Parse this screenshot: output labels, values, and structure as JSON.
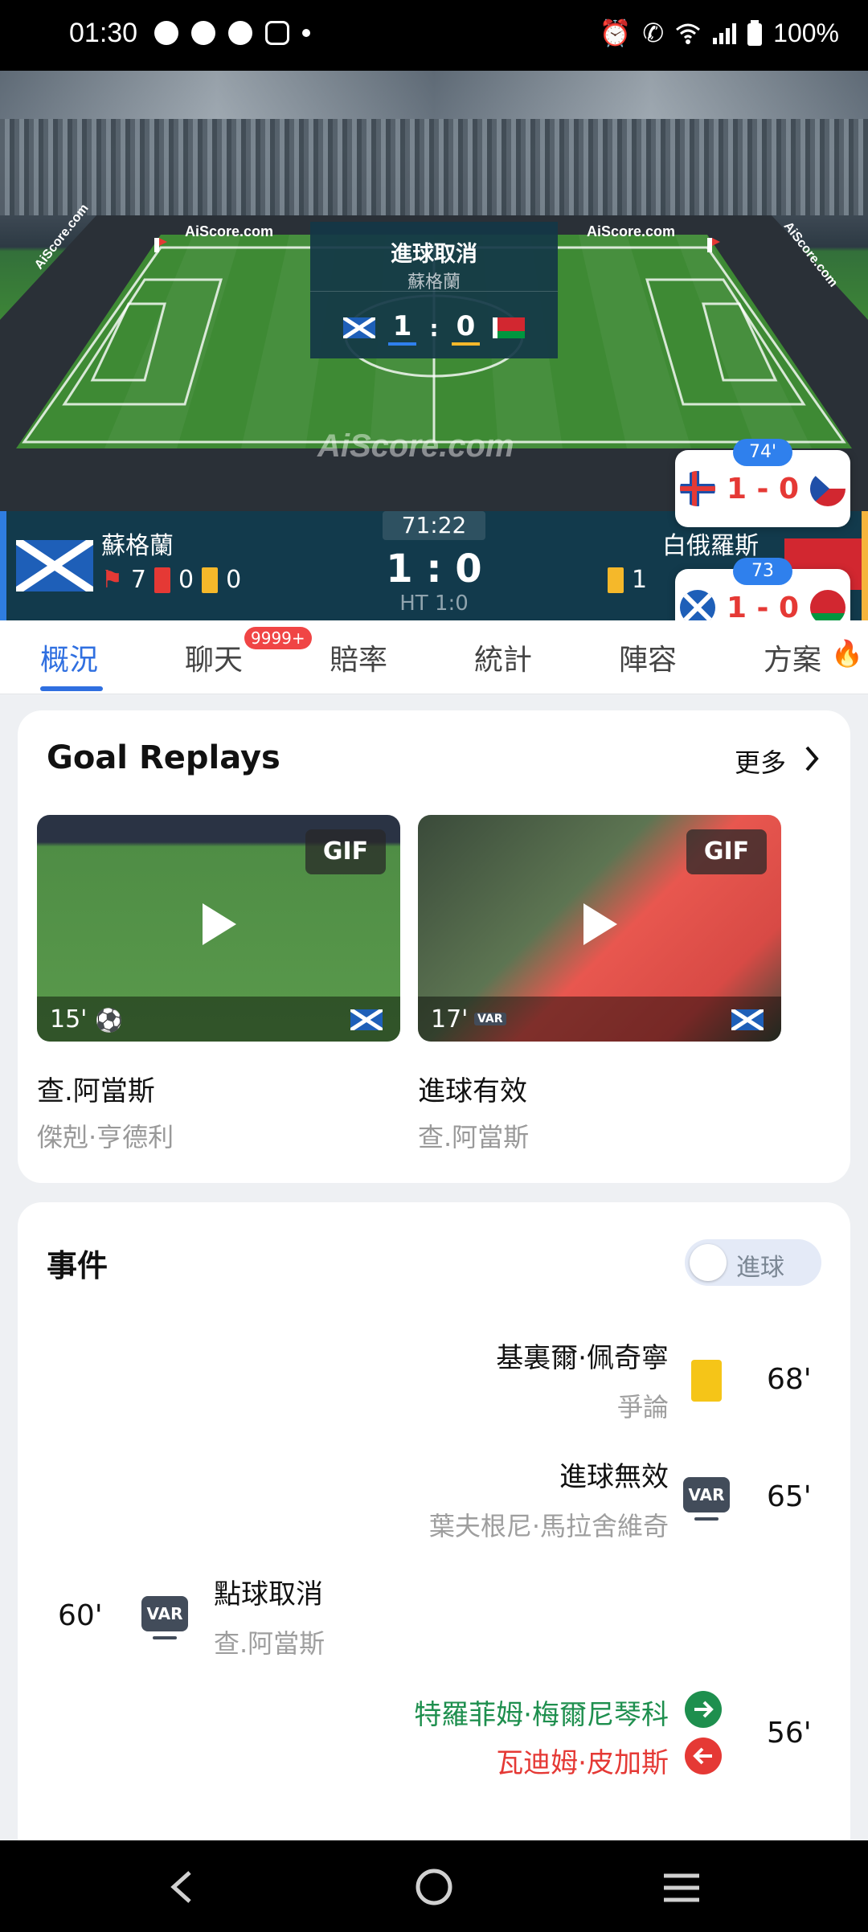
{
  "status_bar": {
    "time": "01:30",
    "battery": "100%",
    "icons": [
      "facebook-icon",
      "messenger-icon",
      "facebook-icon",
      "instagram-icon",
      "dot-icon",
      "alarm-icon",
      "call-icon",
      "wifi-icon",
      "signal-icon",
      "battery-icon"
    ]
  },
  "field": {
    "board_left": "AiScore.com",
    "board_right": "AiScore.com",
    "side_left": "AiScore.com",
    "side_right": "AiScore.com",
    "watermark": "AiScore.com",
    "popup": {
      "title": "進球取消",
      "team": "蘇格蘭",
      "home_score": "1",
      "sep": ":",
      "away_score": "0"
    }
  },
  "scoreboard": {
    "home_name": "蘇格蘭",
    "away_name": "白俄羅斯",
    "home_corners": "7",
    "home_red": "0",
    "home_yellow": "0",
    "away_yellow": "1",
    "clock": "71:22",
    "score": "1 : 0",
    "ht": "HT 1:0"
  },
  "live_cards": [
    {
      "minute": "74'",
      "score": "1 - 0"
    },
    {
      "minute": "73",
      "score": "1 - 0"
    }
  ],
  "tabs": {
    "items": [
      "概況",
      "聊天",
      "賠率",
      "統計",
      "陣容",
      "方案"
    ],
    "chat_badge": "9999+"
  },
  "replays": {
    "title": "Goal Replays",
    "more": "更多",
    "items": [
      {
        "gif": "GIF",
        "minute": "15'",
        "title": "查.阿當斯",
        "sub": "傑剋·亨德利"
      },
      {
        "gif": "GIF",
        "minute": "17'",
        "var": "VAR",
        "title": "進球有效",
        "sub": "查.阿當斯"
      }
    ]
  },
  "events": {
    "title": "事件",
    "toggle_label": "進球",
    "items": [
      {
        "name": "基裏爾·佩奇寧",
        "sub": "爭論",
        "minute": "68'"
      },
      {
        "name": "進球無效",
        "sub": "葉夫根尼·馬拉舍維奇",
        "minute": "65'",
        "icon": "VAR"
      },
      {
        "name": "點球取消",
        "sub": "查.阿當斯",
        "minute": "60'",
        "icon": "VAR"
      },
      {
        "name_in": "特羅菲姆·梅爾尼琴科",
        "name_out": "瓦迪姆·皮加斯",
        "minute": "56'"
      }
    ]
  },
  "colors": {
    "accent": "#2f6fe0",
    "sub_in": "#1e8f4e",
    "sub_out": "#e53935",
    "scoreboard_bg": "#123a4c"
  }
}
